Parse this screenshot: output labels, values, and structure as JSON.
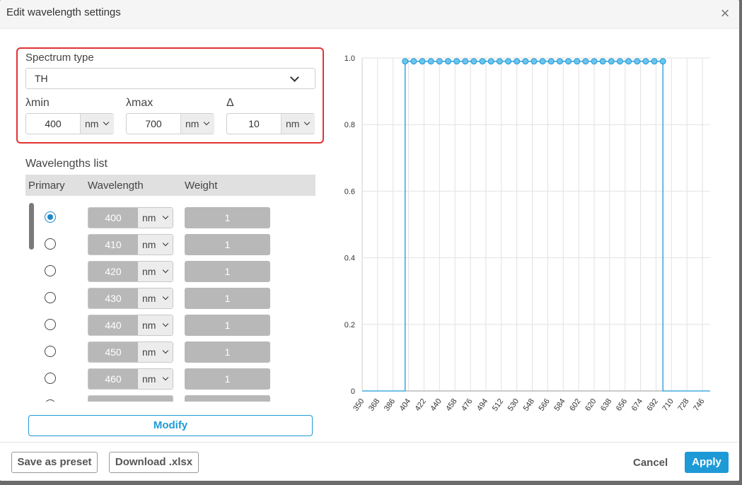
{
  "dialog": {
    "title": "Edit wavelength settings",
    "close_glyph": "×"
  },
  "spectrum": {
    "type_label": "Spectrum type",
    "type_value": "TH",
    "lmin_label": "λmin",
    "lmin_value": "400",
    "lmin_unit": "nm",
    "lmax_label": "λmax",
    "lmax_value": "700",
    "lmax_unit": "nm",
    "delta_label": "Δ",
    "delta_value": "10",
    "delta_unit": "nm"
  },
  "wavelengths": {
    "title": "Wavelengths list",
    "headers": {
      "primary": "Primary",
      "wavelength": "Wavelength",
      "weight": "Weight"
    },
    "rows": [
      {
        "primary": true,
        "wavelength": "400",
        "unit": "nm",
        "weight": "1"
      },
      {
        "primary": false,
        "wavelength": "410",
        "unit": "nm",
        "weight": "1"
      },
      {
        "primary": false,
        "wavelength": "420",
        "unit": "nm",
        "weight": "1"
      },
      {
        "primary": false,
        "wavelength": "430",
        "unit": "nm",
        "weight": "1"
      },
      {
        "primary": false,
        "wavelength": "440",
        "unit": "nm",
        "weight": "1"
      },
      {
        "primary": false,
        "wavelength": "450",
        "unit": "nm",
        "weight": "1"
      },
      {
        "primary": false,
        "wavelength": "460",
        "unit": "nm",
        "weight": "1"
      }
    ],
    "modify_label": "Modify"
  },
  "chart_data": {
    "type": "line",
    "title": "",
    "xlabel": "",
    "ylabel": "",
    "xlim": [
      350,
      755
    ],
    "ylim": [
      0,
      1
    ],
    "grid": true,
    "line_color": "#1e9ad6",
    "marker_fill": "#6cc4ee",
    "x_ticks": [
      350,
      368,
      386,
      404,
      422,
      440,
      458,
      476,
      494,
      512,
      530,
      548,
      566,
      584,
      602,
      620,
      638,
      656,
      674,
      692,
      710,
      728,
      746
    ],
    "y_ticks": [
      0,
      0.2,
      0.4,
      0.6,
      0.8,
      1.0
    ],
    "y_tick_labels": [
      "0",
      "0.2",
      "0.4",
      "0.6",
      "0.8",
      "1.0"
    ],
    "series": [
      {
        "x": [
          400,
          410,
          420,
          430,
          440,
          450,
          460,
          470,
          480,
          490,
          500,
          510,
          520,
          530,
          540,
          550,
          560,
          570,
          580,
          590,
          600,
          610,
          620,
          630,
          640,
          650,
          660,
          670,
          680,
          690,
          700
        ],
        "y": [
          0.99,
          0.99,
          0.99,
          0.99,
          0.99,
          0.99,
          0.99,
          0.99,
          0.99,
          0.99,
          0.99,
          0.99,
          0.99,
          0.99,
          0.99,
          0.99,
          0.99,
          0.99,
          0.99,
          0.99,
          0.99,
          0.99,
          0.99,
          0.99,
          0.99,
          0.99,
          0.99,
          0.99,
          0.99,
          0.99,
          0.99
        ]
      }
    ]
  },
  "footer": {
    "save_preset": "Save as preset",
    "download": "Download .xlsx",
    "cancel": "Cancel",
    "apply": "Apply"
  }
}
